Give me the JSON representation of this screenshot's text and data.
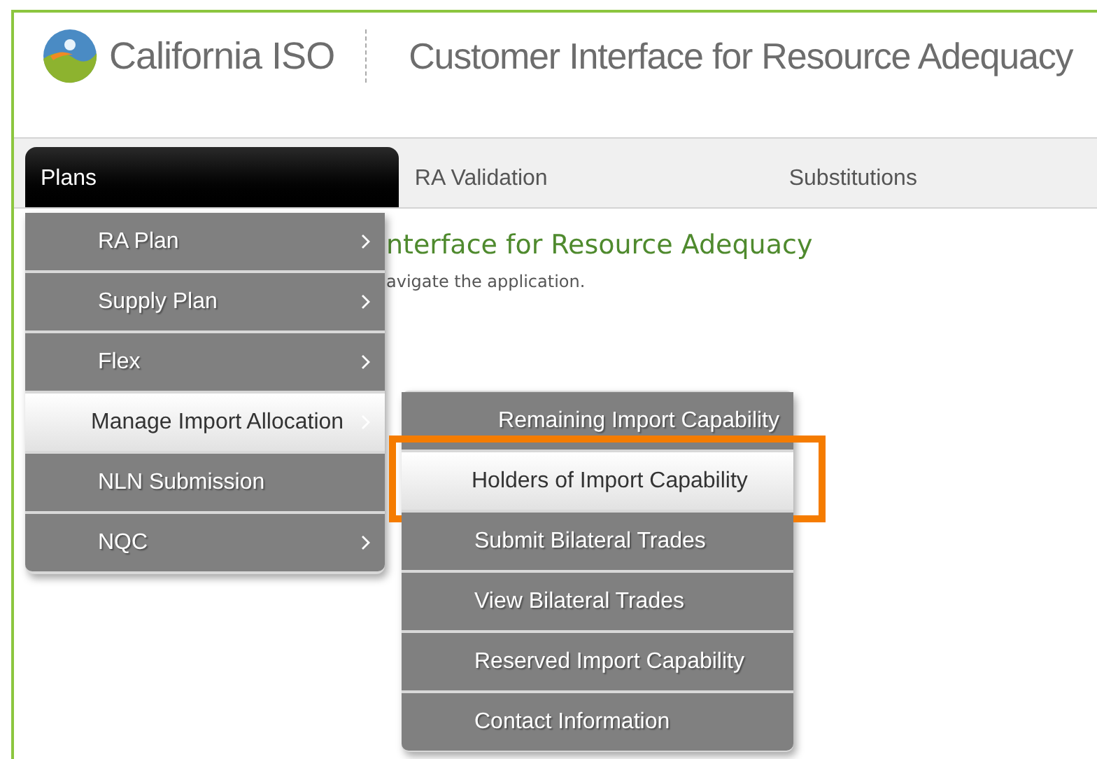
{
  "header": {
    "logo_text": "California ISO",
    "app_title": "Customer Interface for Resource Adequacy"
  },
  "nav_tabs": [
    {
      "label": "Plans",
      "selected": true
    },
    {
      "label": "RA Validation",
      "selected": false
    },
    {
      "label": "Substitutions",
      "selected": false
    }
  ],
  "welcome": {
    "heading": "nterface for Resource Adequacy",
    "text": "avigate the application."
  },
  "plans_menu": [
    {
      "label": "RA Plan",
      "selected": false,
      "has_submenu": true
    },
    {
      "label": "Supply Plan",
      "selected": false,
      "has_submenu": true
    },
    {
      "label": "Flex",
      "selected": false,
      "has_submenu": true
    },
    {
      "label": "Manage Import Allocation",
      "selected": true,
      "has_submenu": true
    },
    {
      "label": "NLN Submission",
      "selected": false,
      "has_submenu": false
    },
    {
      "label": "NQC",
      "selected": false,
      "has_submenu": true
    }
  ],
  "submenu": [
    {
      "label": "Remaining Import Capability",
      "selected": false,
      "highlighted": false
    },
    {
      "label": "Holders of Import Capability",
      "selected": true,
      "highlighted": true
    },
    {
      "label": "Submit Bilateral Trades",
      "selected": false,
      "highlighted": false
    },
    {
      "label": "View Bilateral Trades",
      "selected": false,
      "highlighted": false
    },
    {
      "label": "Reserved Import Capability",
      "selected": false,
      "highlighted": false
    },
    {
      "label": "Contact Information",
      "selected": false,
      "highlighted": false
    }
  ]
}
